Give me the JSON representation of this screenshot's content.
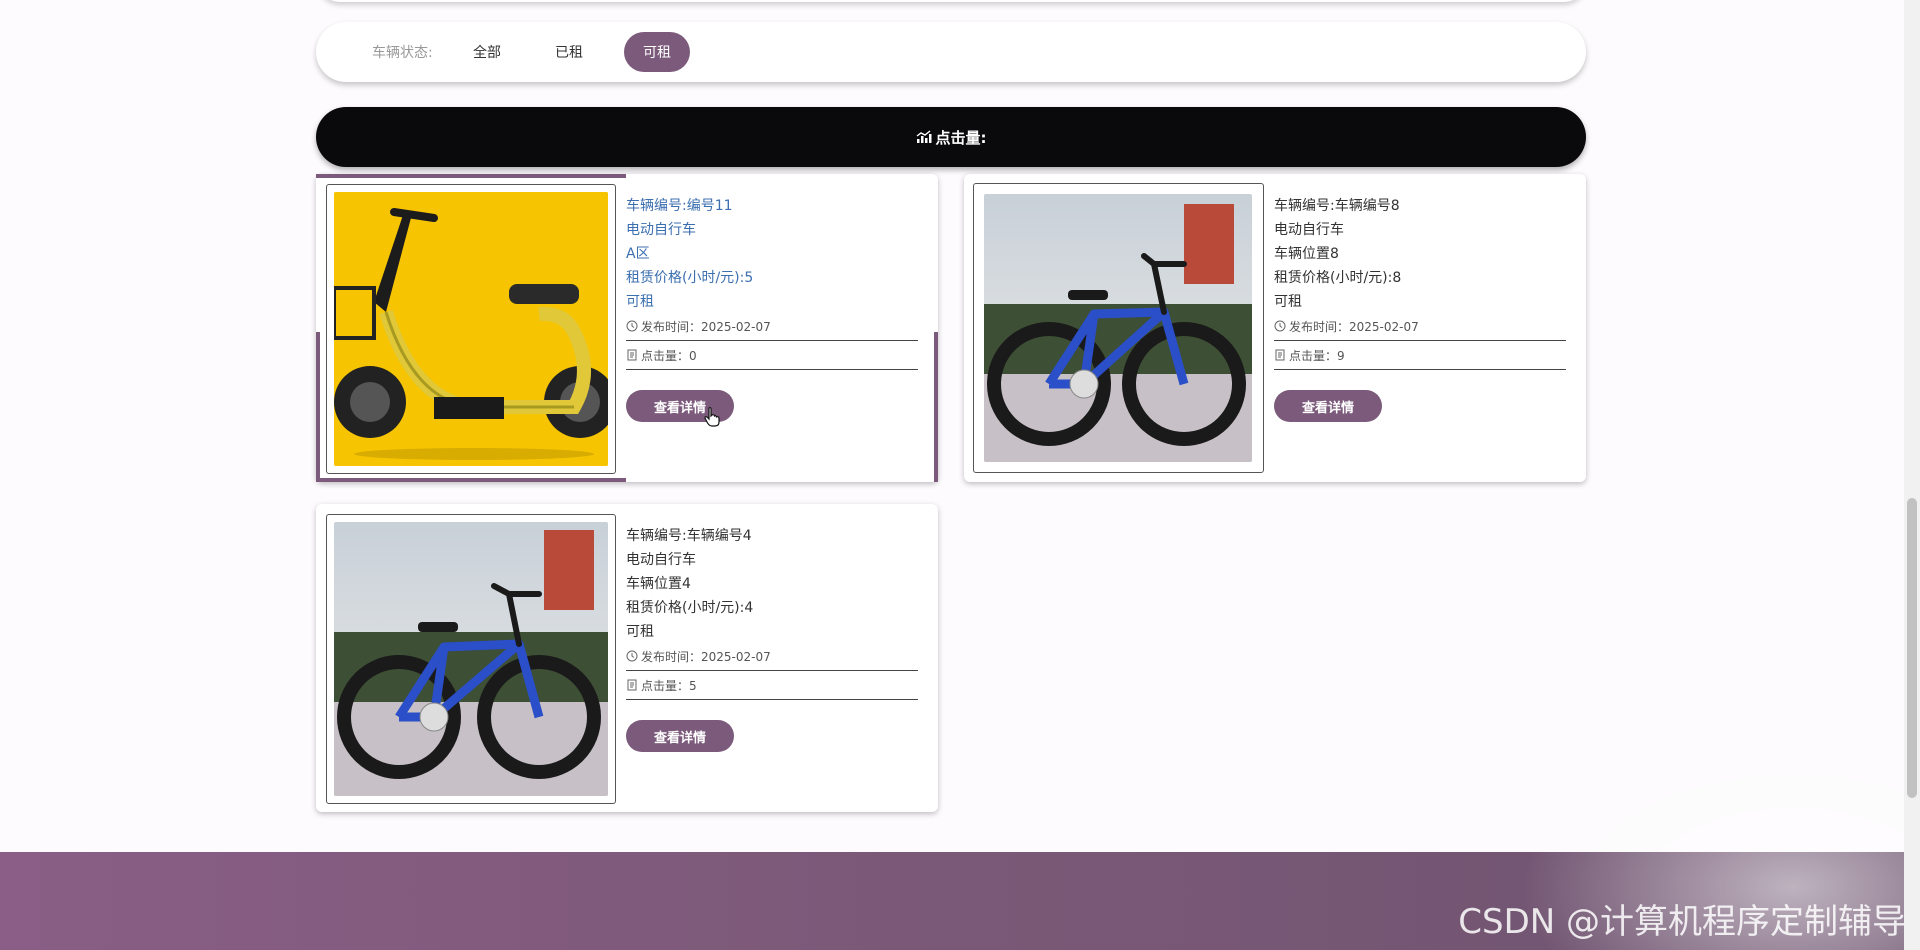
{
  "filter": {
    "label": "车辆状态:",
    "options": [
      "全部",
      "已租",
      "可租"
    ],
    "active": "可租"
  },
  "click_bar": {
    "label": "点击量:"
  },
  "cards": [
    {
      "vehicle_no": "车辆编号:编号11",
      "type": "电动自行车",
      "location": "A区",
      "price": "租赁价格(小时/元):5",
      "status": "可租",
      "publish": "发布时间：2025-02-07",
      "clicks": "点击量：0",
      "button": "查看详情"
    },
    {
      "vehicle_no": "车辆编号:车辆编号8",
      "type": "电动自行车",
      "location": "车辆位置8",
      "price": "租赁价格(小时/元):8",
      "status": "可租",
      "publish": "发布时间：2025-02-07",
      "clicks": "点击量：9",
      "button": "查看详情"
    },
    {
      "vehicle_no": "车辆编号:车辆编号4",
      "type": "电动自行车",
      "location": "车辆位置4",
      "price": "租赁价格(小时/元):4",
      "status": "可租",
      "publish": "发布时间：2025-02-07",
      "clicks": "点击量：5",
      "button": "查看详情"
    }
  ],
  "watermark": "CSDN @计算机程序定制辅导",
  "colors": {
    "accent": "#7b5a7b",
    "link_blue": "#3c6fb0",
    "bar_black": "#0a0a0c"
  },
  "icons": [
    "chart-icon",
    "clock-icon",
    "document-icon",
    "cursor-pointer-icon"
  ]
}
